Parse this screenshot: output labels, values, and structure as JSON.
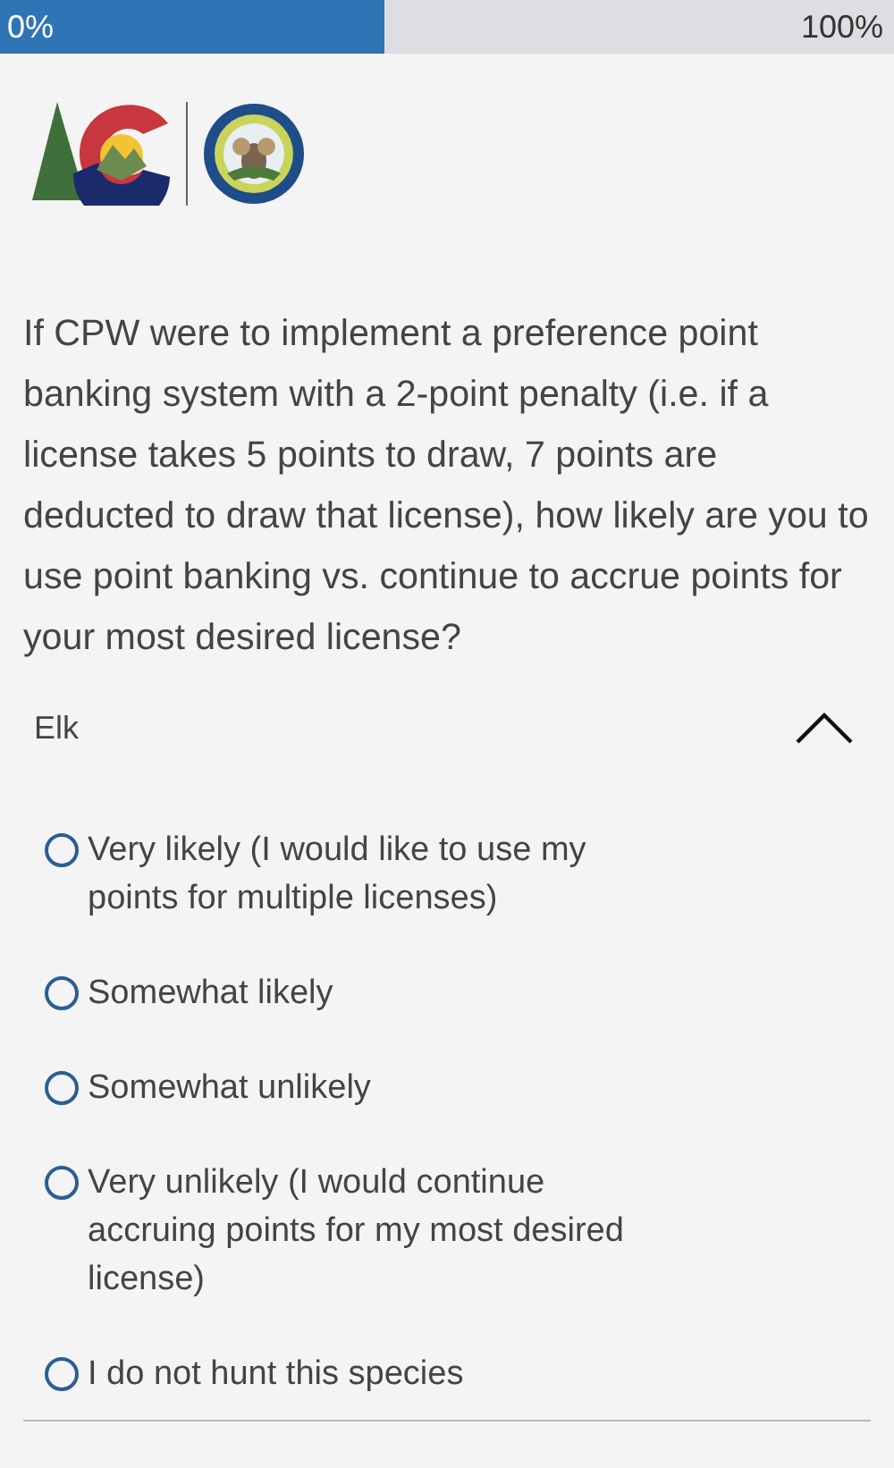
{
  "progress": {
    "level": 0.43,
    "start_label": "0%",
    "end_label": "100%"
  },
  "question": "If CPW were to implement a preference point banking system with a 2-point penalty (i.e. if a license takes 5 points to draw, 7 points are deducted to draw that license), how likely are you to use point banking vs. continue to accrue points for your most desired license?",
  "section": {
    "title": "Elk",
    "expanded": true
  },
  "options": [
    {
      "label": "Very likely (I would like to use my points for multiple licenses)",
      "selected": false
    },
    {
      "label": "Somewhat likely",
      "selected": false
    },
    {
      "label": "Somewhat unlikely",
      "selected": false
    },
    {
      "label": "Very unlikely (I would continue accruing points for my most desired license)",
      "selected": false
    },
    {
      "label": "I do not hunt this species",
      "selected": false
    }
  ]
}
